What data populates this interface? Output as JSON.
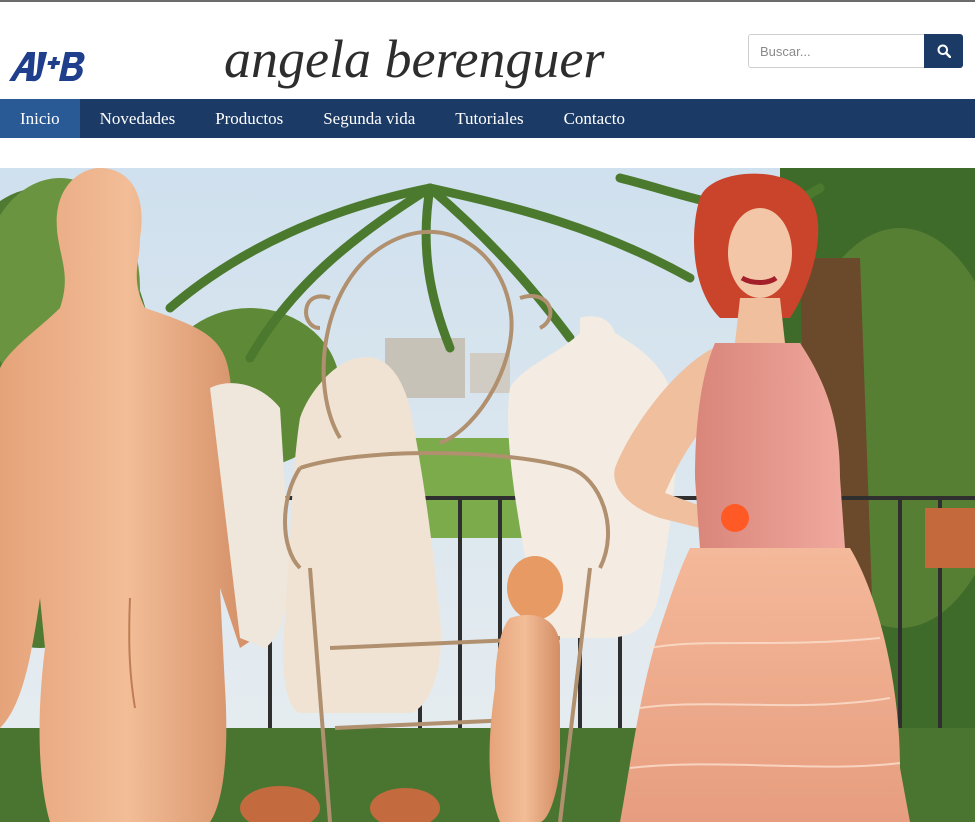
{
  "site": {
    "brand_title": "angela berenguer",
    "logo_text": "AJ+B"
  },
  "search": {
    "placeholder": "Buscar...",
    "icon": "search-icon"
  },
  "nav": {
    "items": [
      {
        "label": "Inicio",
        "active": true
      },
      {
        "label": "Novedades",
        "active": false
      },
      {
        "label": "Productos",
        "active": false
      },
      {
        "label": "Segunda vida",
        "active": false
      },
      {
        "label": "Tutoriales",
        "active": false
      },
      {
        "label": "Contacto",
        "active": false
      }
    ]
  },
  "colors": {
    "nav_bg": "#1b3a66",
    "nav_active": "#2a5a96",
    "logo_blue": "#1f3e8c"
  }
}
